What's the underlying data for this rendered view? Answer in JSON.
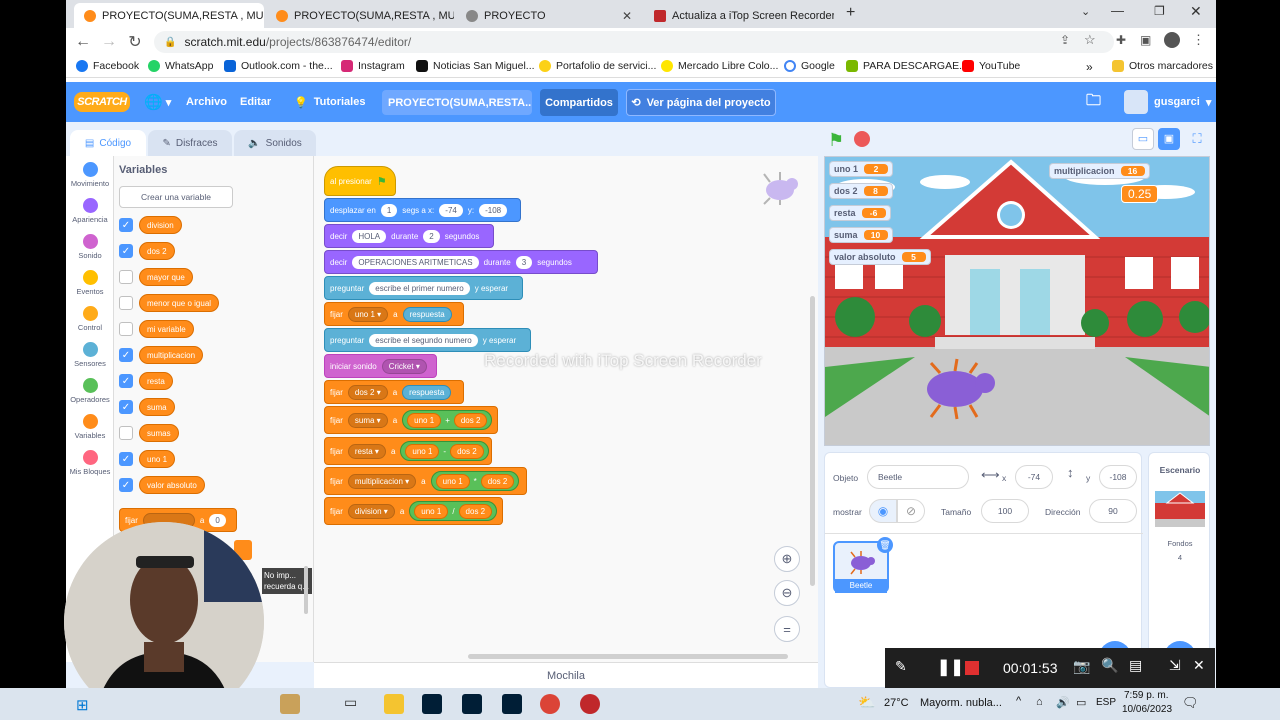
{
  "tabs": [
    {
      "label": "PROYECTO(SUMA,RESTA , MULTI",
      "active": true,
      "color": "#ff8c1a"
    },
    {
      "label": "PROYECTO(SUMA,RESTA , MULTI",
      "active": false,
      "color": "#ff8c1a"
    },
    {
      "label": "PROYECTO",
      "active": false,
      "color": "#888888"
    },
    {
      "label": "Actualiza a iTop Screen Recorder",
      "active": false,
      "color": "#c0282b"
    }
  ],
  "address": {
    "host": "scratch.mit.edu",
    "path": "/projects/863876474/editor/"
  },
  "bookmarks": [
    "Facebook",
    "WhatsApp",
    "Outlook.com - the...",
    "Instagram",
    "Noticias San Miguel...",
    "Portafolio de servici...",
    "Mercado Libre Colo...",
    "Google",
    "PARA DESCARGAE...",
    "YouTube",
    "Otros marcadores"
  ],
  "menubar": {
    "logo": "SCRATCH",
    "file": "Archivo",
    "edit": "Editar",
    "tutorials": "Tutoriales",
    "project_title": "PROYECTO(SUMA,RESTA...",
    "share": "Compartidos",
    "view_page": "Ver página del proyecto",
    "username": "gusgarci"
  },
  "editor_tabs": {
    "code": "Código",
    "costumes": "Disfraces",
    "sounds": "Sonidos"
  },
  "categories": [
    {
      "label": "Movimiento",
      "color": "#4c97ff"
    },
    {
      "label": "Apariencia",
      "color": "#9966ff"
    },
    {
      "label": "Sonido",
      "color": "#cf63cf"
    },
    {
      "label": "Eventos",
      "color": "#ffbf00"
    },
    {
      "label": "Control",
      "color": "#ffab19"
    },
    {
      "label": "Sensores",
      "color": "#5cb1d6"
    },
    {
      "label": "Operadores",
      "color": "#59c059"
    },
    {
      "label": "Variables",
      "color": "#ff8c1a"
    },
    {
      "label": "Mis Bloques",
      "color": "#ff6680"
    }
  ],
  "palette": {
    "heading": "Variables",
    "make_variable": "Crear una variable",
    "variables": [
      {
        "name": "division",
        "checked": true
      },
      {
        "name": "dos 2",
        "checked": true
      },
      {
        "name": "mayor que",
        "checked": false
      },
      {
        "name": "menor que o igual",
        "checked": false
      },
      {
        "name": "mi variable",
        "checked": false
      },
      {
        "name": "multiplicacion",
        "checked": true
      },
      {
        "name": "resta",
        "checked": true
      },
      {
        "name": "suma",
        "checked": true
      },
      {
        "name": "sumas",
        "checked": false
      },
      {
        "name": "uno 1",
        "checked": true
      },
      {
        "name": "valor absoluto",
        "checked": true
      }
    ],
    "set_block": {
      "label": "fijar",
      "value": "0"
    },
    "partial_text": "No imp... recuerda q..."
  },
  "script": {
    "hat": {
      "when": "al presionar"
    },
    "glide": {
      "label": "desplazar en",
      "secs": "1",
      "mid": "segs a x:",
      "x": "-74",
      "ylabel": "y:",
      "y": "-108"
    },
    "say1": {
      "label": "decir",
      "text": "HOLA",
      "during": "durante",
      "secs": "2",
      "unit": "segundos"
    },
    "say2": {
      "label": "decir",
      "text": "OPERACIONES ARITMETICAS",
      "during": "durante",
      "secs": "3",
      "unit": "segundos"
    },
    "ask1": {
      "label": "preguntar",
      "text": "escribe el primer numero",
      "wait": "y esperar"
    },
    "set1": {
      "label": "fijar",
      "var": "uno 1",
      "to": "a",
      "value": "respuesta"
    },
    "ask2": {
      "label": "preguntar",
      "text": "escribe el segundo numero",
      "wait": "y esperar"
    },
    "sound": {
      "label": "iniciar sonido",
      "value": "Cricket"
    },
    "set2": {
      "label": "fijar",
      "var": "dos 2",
      "to": "a",
      "value": "respuesta"
    },
    "set3": {
      "label": "fijar",
      "var": "suma",
      "to": "a",
      "a": "uno 1",
      "op": "+",
      "b": "dos 2"
    },
    "set4": {
      "label": "fijar",
      "var": "resta",
      "to": "a",
      "a": "uno 1",
      "op": "-",
      "b": "dos 2"
    },
    "set5": {
      "label": "fijar",
      "var": "multiplicacion",
      "to": "a",
      "a": "uno 1",
      "op": "*",
      "b": "dos 2"
    },
    "set6": {
      "label": "fijar",
      "var": "division",
      "to": "a",
      "a": "uno 1",
      "op": "/",
      "b": "dos 2"
    }
  },
  "watermark": "Recorded with iTop Screen Recorder",
  "backpack": "Mochila",
  "monitors": [
    {
      "name": "uno 1",
      "value": "2"
    },
    {
      "name": "dos 2",
      "value": "8"
    },
    {
      "name": "resta",
      "value": "-6"
    },
    {
      "name": "suma",
      "value": "10"
    },
    {
      "name": "valor absoluto",
      "value": "5"
    },
    {
      "name": "multiplicacion",
      "value": "16"
    }
  ],
  "large_monitor_value": "0.25",
  "sprite_info": {
    "object_label": "Objeto",
    "object_value": "Beetle",
    "x_label": "x",
    "x": "-74",
    "y_label": "y",
    "y": "-108",
    "show_label": "mostrar",
    "size_label": "Tamaño",
    "size": "100",
    "direction_label": "Dirección",
    "direction": "90",
    "sprite_thumb": "Beetle"
  },
  "scene": {
    "title": "Escenario",
    "backdrops_label": "Fondos",
    "backdrops_count": "4"
  },
  "recorder": {
    "time": "00:01:53"
  },
  "taskbar": {
    "weather": "27°C",
    "weather_text": "Mayorm. nubla...",
    "lang": "ESP",
    "time": "7:59 p. m.",
    "date": "10/06/2023"
  }
}
